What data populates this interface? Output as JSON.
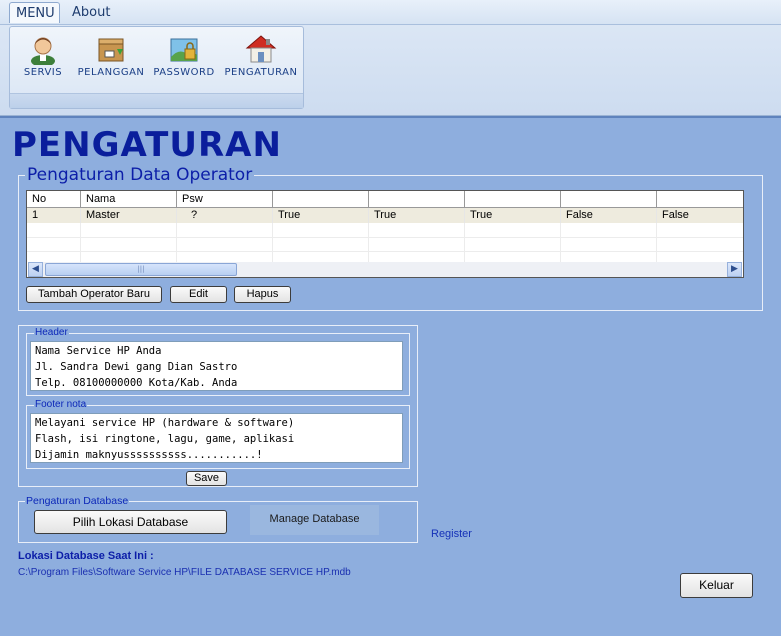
{
  "ribbon": {
    "tabs": [
      {
        "label": "MENU"
      },
      {
        "label": "About"
      }
    ],
    "buttons": [
      {
        "label": "SERVIS",
        "icon": "user-icon"
      },
      {
        "label": "PELANGGAN",
        "icon": "package-icon"
      },
      {
        "label": "PASSWORD",
        "icon": "password-icon"
      },
      {
        "label": "PENGATURAN",
        "icon": "house-icon"
      }
    ]
  },
  "page": {
    "title": "PENGATURAN"
  },
  "operator_section": {
    "legend": "Pengaturan Data Operator",
    "columns": [
      "No",
      "Nama",
      "Psw",
      "",
      "",
      "",
      "",
      ""
    ],
    "rows": [
      [
        "1",
        "Master",
        "?",
        "True",
        "True",
        "True",
        "False",
        "False"
      ]
    ],
    "buttons": {
      "add": "Tambah Operator Baru",
      "edit": "Edit",
      "delete": "Hapus"
    }
  },
  "header_section": {
    "legend": "Header",
    "lines": [
      "Nama Service HP Anda",
      "Jl. Sandra Dewi gang Dian Sastro",
      "Telp. 08100000000 Kota/Kab. Anda"
    ]
  },
  "footer_section": {
    "legend": "Footer nota",
    "lines": [
      "Melayani service HP (hardware & software)",
      "Flash, isi ringtone, lagu, game, aplikasi",
      "Dijamin maknyussssssssss...........!"
    ]
  },
  "save_label": "Save",
  "database_section": {
    "legend": "Pengaturan Database",
    "choose_label": "Pilih Lokasi Database",
    "manage_label": "Manage Database",
    "register_label": "Register",
    "current_label": "Lokasi Database Saat Ini :",
    "current_path": "C:\\Program Files\\Software Service HP\\FILE DATABASE SERVICE HP.mdb"
  },
  "exit_label": "Keluar",
  "colors": {
    "title": "#0a1e9c",
    "background": "#8eaede",
    "legend": "#0c27b8"
  }
}
